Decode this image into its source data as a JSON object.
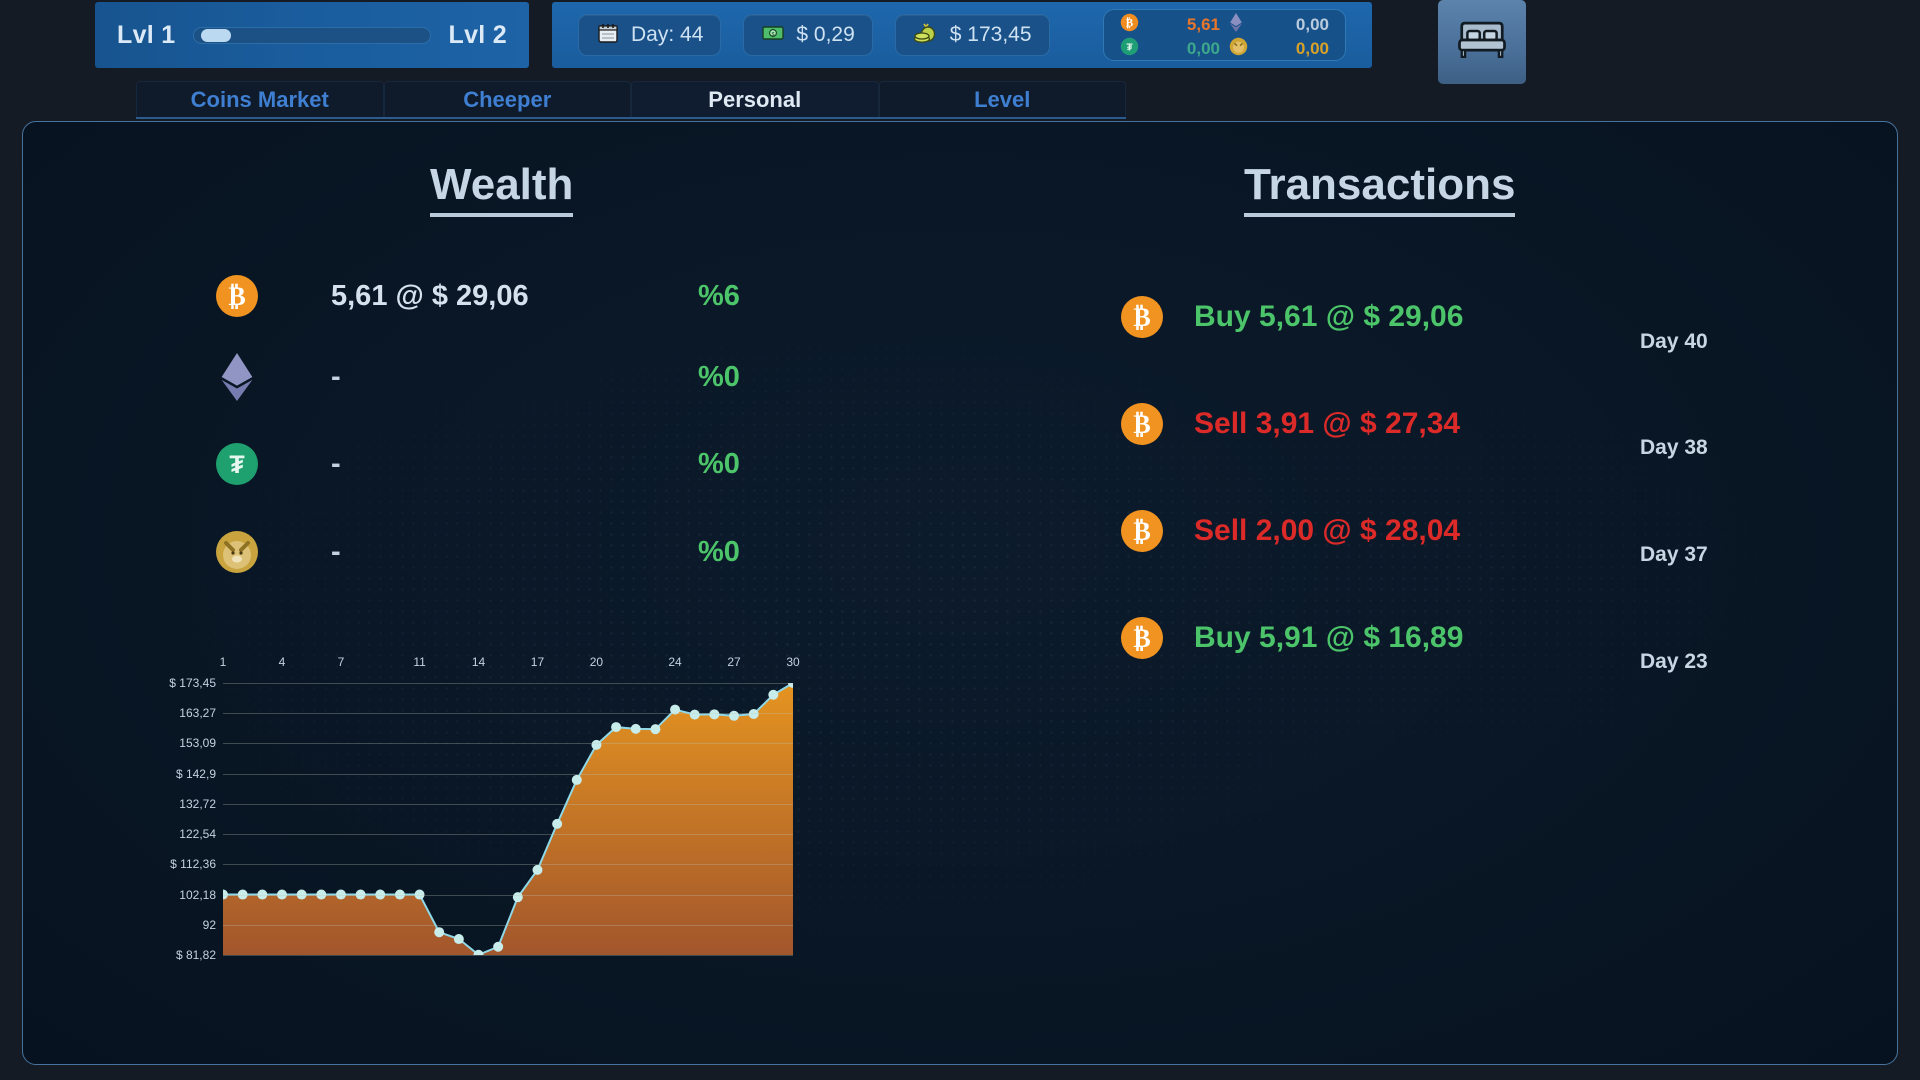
{
  "topbar": {
    "level_left": "Lvl 1",
    "level_right": "Lvl 2",
    "progress_percent": 3,
    "stats": [
      {
        "icon": "calendar-icon",
        "label": "Day: 44"
      },
      {
        "icon": "cash-icon",
        "label": "$ 0,29"
      },
      {
        "icon": "money-bag-icon",
        "label": "$ 173,45"
      }
    ],
    "holdings": [
      {
        "icon": "bitcoin-icon",
        "value": "5,61",
        "color": "#e8762a"
      },
      {
        "icon": "ethereum-icon",
        "value": "0,00",
        "color": "#b9cbdd"
      },
      {
        "icon": "tether-icon",
        "value": "0,00",
        "color": "#3da98a"
      },
      {
        "icon": "dogecoin-icon",
        "value": "0,00",
        "color": "#d9a227"
      }
    ],
    "sleep_button_icon": "bed-icon"
  },
  "tabs": [
    {
      "label": "Coins Market",
      "active": false
    },
    {
      "label": "Cheeper",
      "active": false
    },
    {
      "label": "Personal",
      "active": true
    },
    {
      "label": "Level",
      "active": false
    }
  ],
  "wealth": {
    "title": "Wealth",
    "rows": [
      {
        "icon": "bitcoin-icon",
        "amount": "5,61  @  $ 29,06",
        "percent": "%6"
      },
      {
        "icon": "ethereum-icon",
        "amount": "-",
        "percent": "%0"
      },
      {
        "icon": "tether-icon",
        "amount": "-",
        "percent": "%0"
      },
      {
        "icon": "dogecoin-icon",
        "amount": "-",
        "percent": "%0"
      }
    ]
  },
  "transactions": {
    "title": "Transactions",
    "rows": [
      {
        "icon": "bitcoin-icon",
        "text": "Buy 5,61  @  $ 29,06",
        "type": "buy",
        "day": "Day 40"
      },
      {
        "icon": "bitcoin-icon",
        "text": "Sell 3,91  @  $ 27,34",
        "type": "sell",
        "day": "Day 38"
      },
      {
        "icon": "bitcoin-icon",
        "text": "Sell 2,00  @  $ 28,04",
        "type": "sell",
        "day": "Day 37"
      },
      {
        "icon": "bitcoin-icon",
        "text": "Buy 5,91  @  $ 16,89",
        "type": "buy",
        "day": "Day 23"
      }
    ]
  },
  "chart_data": {
    "type": "area",
    "title": "",
    "xlabel": "",
    "ylabel": "",
    "grid": true,
    "legend": "none",
    "line_color": "#8fd8e8",
    "point_color": "#c7ecea",
    "fill_color_top": "#e0921f",
    "fill_color_bottom": "#a85b2c",
    "xtick_labels": [
      "1",
      "4",
      "7",
      "11",
      "14",
      "17",
      "20",
      "24",
      "27",
      "30"
    ],
    "xtick_indices": [
      1,
      4,
      7,
      11,
      14,
      17,
      20,
      24,
      27,
      30
    ],
    "ytick_labels": [
      "$ 173,45",
      "163,27",
      "153,09",
      "$ 142,9",
      "132,72",
      "122,54",
      "$ 112,36",
      "102,18",
      "92",
      "$ 81,82"
    ],
    "ytick_values": [
      173.45,
      163.27,
      153.09,
      142.9,
      132.72,
      122.54,
      112.36,
      102.18,
      92,
      81.82
    ],
    "ylim": [
      81.82,
      173.45
    ],
    "xlim": [
      1,
      30
    ],
    "x": [
      1,
      2,
      3,
      4,
      5,
      6,
      7,
      8,
      9,
      10,
      11,
      12,
      13,
      14,
      15,
      16,
      17,
      18,
      19,
      20,
      21,
      22,
      23,
      24,
      25,
      26,
      27,
      28,
      29,
      30
    ],
    "values": [
      102.18,
      102.18,
      102.18,
      102.18,
      102.18,
      102.18,
      102.18,
      102.18,
      102.18,
      102.18,
      102.18,
      89.5,
      87.2,
      81.9,
      84.6,
      101.3,
      110.5,
      126.0,
      140.8,
      152.6,
      158.6,
      158.0,
      157.9,
      164.5,
      162.8,
      162.9,
      162.4,
      163.0,
      169.5,
      173.45
    ]
  }
}
